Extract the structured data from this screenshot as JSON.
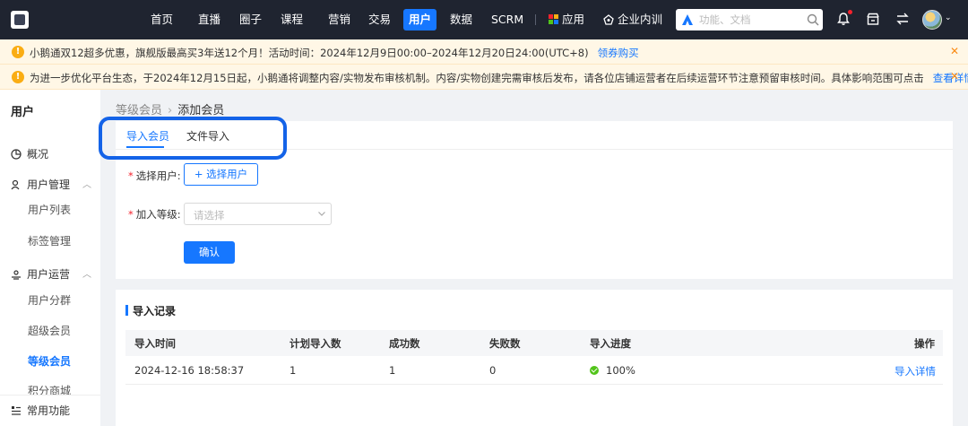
{
  "nav": {
    "items": [
      "首页",
      "直播",
      "圈子",
      "课程",
      "营销",
      "交易",
      "用户",
      "数据",
      "SCRM",
      "应用",
      "企业内训"
    ],
    "active": "用户"
  },
  "search": {
    "placeholder": "功能、文档"
  },
  "notices": [
    {
      "text": "小鹅通双12超多优惠，旗舰版最高买3年送12个月！活动时间：2024年12月9日00:00–2024年12月20日24:00(UTC+8)",
      "link": "领券购买"
    },
    {
      "text": "为进一步优化平台生态，于2024年12月15日起，小鹅通将调整内容/实物发布审核机制。内容/实物创建完需审核后发布，请各位店铺运营者在后续运营环节注意预留审核时间。具体影响范围可点击",
      "link": "查看详情"
    }
  ],
  "sidebar": {
    "title": "用户",
    "overview": "概况",
    "user_mgmt": "用户管理",
    "user_list": "用户列表",
    "tag_mgmt": "标签管理",
    "user_ops": "用户运营",
    "user_group": "用户分群",
    "super_member": "超级会员",
    "level_member": "等级会员",
    "points_mall": "积分商城",
    "common_func": "常用功能"
  },
  "breadcrumb": {
    "parent": "等级会员",
    "current": "添加会员"
  },
  "tabs": {
    "import_member": "导入会员",
    "file_import": "文件导入"
  },
  "form": {
    "select_user_label": "选择用户:",
    "select_user_button": "+ 选择用户",
    "level_label": "加入等级:",
    "level_placeholder": "请选择",
    "confirm": "确认"
  },
  "records": {
    "title": "导入记录",
    "columns": [
      "导入时间",
      "计划导入数",
      "成功数",
      "失败数",
      "导入进度",
      "操作"
    ],
    "rows": [
      {
        "time": "2024-12-16 18:58:37",
        "planned": "1",
        "success": "1",
        "failed": "0",
        "progress": "100%",
        "action": "导入详情"
      }
    ]
  },
  "colors": {
    "primary": "#1677ff",
    "topbar": "#1f2430",
    "notice_bg": "#fff7e6",
    "highlight": "#1463e8",
    "success": "#52c41a"
  }
}
